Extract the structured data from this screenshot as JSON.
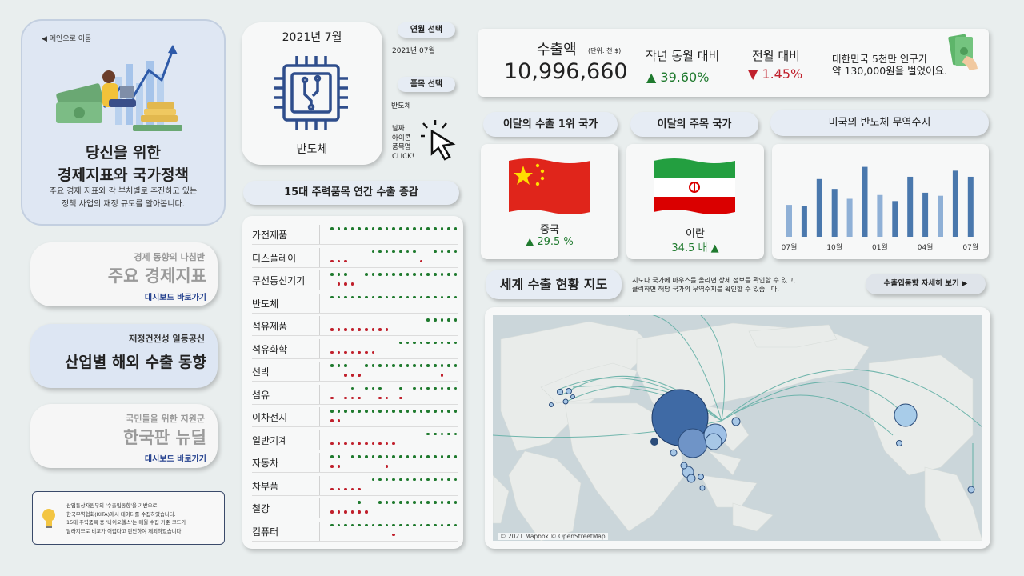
{
  "sidebar": {
    "back_link": "◀ 메인으로 이동",
    "title_line1": "당신을 위한",
    "title_line2": "경제지표와 국가정책",
    "description_line1": "주요 경제 지표와 각 부처별로 추진하고 있는",
    "description_line2": "정책 사업의 재정 규모를 알아봅니다.",
    "nav": [
      {
        "sub": "경제 동향의 나침반",
        "big": "주요 경제지표",
        "link": "대시보드 바로가기"
      },
      {
        "sub": "재정건전성 일등공신",
        "big": "산업별 해외 수출 동향",
        "link": ""
      },
      {
        "sub": "국민들을 위한 지원군",
        "big": "한국판 뉴딜",
        "link": "대시보드 바로가기"
      }
    ],
    "note_lines": [
      "산업통상자원부의 '수출입동향'을 기반으로",
      "한국무역협회(KITA)에서 데이터를 수집하였습니다.",
      "15대 주력품목 중 '바이오헬스'는 매월 수집 기준 코드가",
      "달라지므로 비교가 어렵다고 판단하여 제외하였습니다."
    ]
  },
  "selector": {
    "month_title": "2021년 7월",
    "item_name": "반도체",
    "month_button": "연월 선택",
    "month_value": "2021년 07월",
    "item_button": "품목 선택",
    "item_value": "반도체",
    "hint_lines": [
      "날짜",
      "아이콘",
      "품목명",
      "CLICK!"
    ]
  },
  "items_section": {
    "title": "15대 주력품목 연간 수출 증감",
    "items": [
      "가전제품",
      "디스플레이",
      "무선통신기기",
      "반도체",
      "석유제품",
      "석유화학",
      "선박",
      "섬유",
      "이차전지",
      "일반기계",
      "자동차",
      "차부품",
      "철강",
      "컴퓨터"
    ],
    "dot_colors": {
      "increase": "#1f7a2e",
      "decrease": "#c0202c"
    }
  },
  "summary": {
    "export_label": "수출액",
    "unit": "(단위: 천 $)",
    "export_value": "10,996,660",
    "yoy_label": "작년 동월 대비",
    "yoy_value": "▲ 39.60%",
    "mom_label": "전월 대비",
    "mom_value": "▼ 1.45%",
    "per_capita_line1": "대한민국 5천만 인구가",
    "per_capita_line2": "약 130,000원을 벌었어요."
  },
  "countries": {
    "top_button": "이달의 수출 1위 국가",
    "watch_button": "이달의 주목 국가",
    "trade_button": "미국의 반도체 무역수지",
    "top_name": "중국",
    "top_change": "▲ 29.5 %",
    "watch_name": "이란",
    "watch_change": "34.5 배 ▲"
  },
  "chart_data": {
    "type": "bar",
    "categories": [
      "07월",
      "08월",
      "09월",
      "10월",
      "11월",
      "12월",
      "01월",
      "02월",
      "03월",
      "04월",
      "05월",
      "06월",
      "07월"
    ],
    "tick_labels": [
      "07월",
      "10월",
      "01월",
      "04월",
      "07월"
    ],
    "values": [
      42,
      40,
      76,
      63,
      50,
      92,
      55,
      47,
      79,
      58,
      54,
      87,
      79
    ],
    "bar_color": "#4a78ad",
    "alt_bar_color": "#8fb0d6"
  },
  "map_section": {
    "title": "세계 수출 현황 지도",
    "help_line1": "지도나 국가에 마우스를 올리면 상세 정보를 확인할 수 있고,",
    "help_line2": "클릭하면 해당 국가의 무역수지를 확인할 수 있습니다.",
    "detail_button": "수출입동향 자세히 보기 ▶",
    "attribution": "© 2021 Mapbox © OpenStreetMap"
  }
}
